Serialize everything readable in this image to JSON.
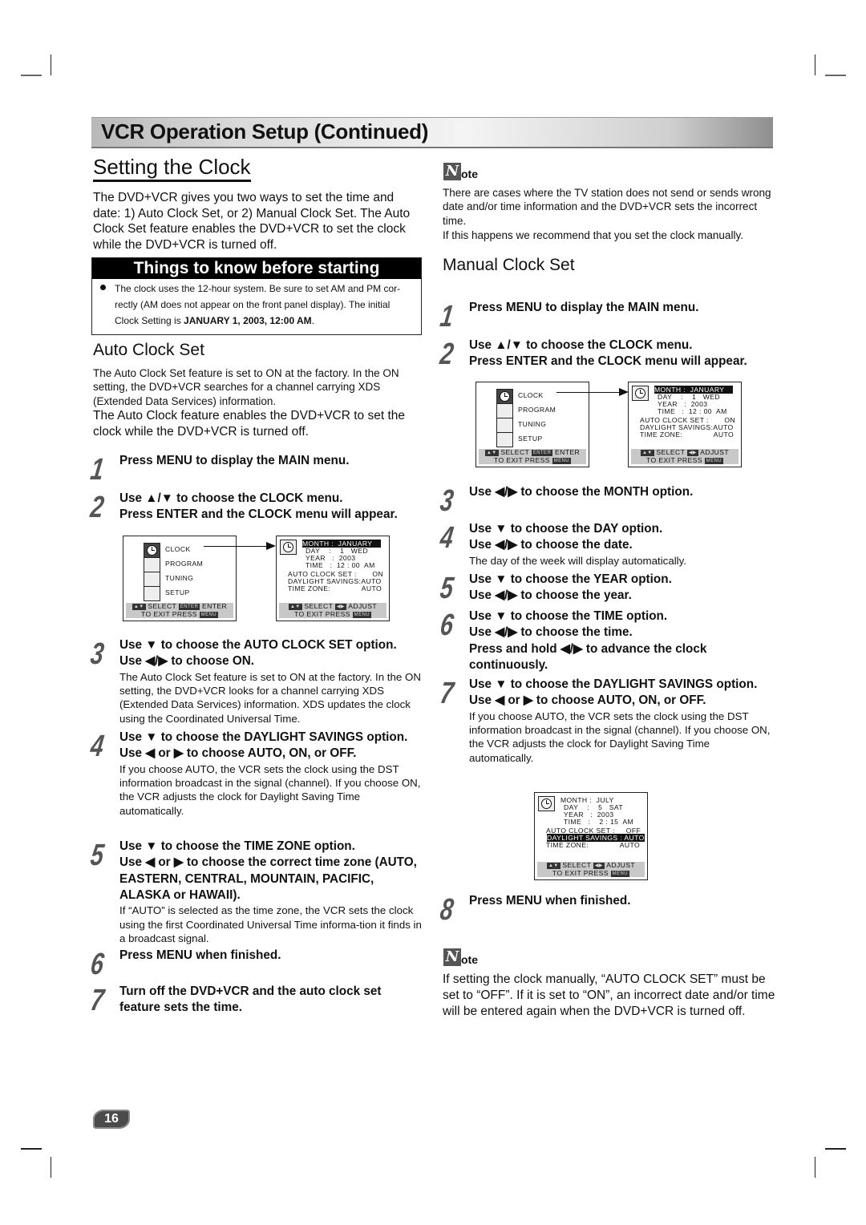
{
  "header": {
    "banner_title": "VCR Operation Setup (Continued)"
  },
  "left": {
    "section_title": "Setting the Clock",
    "intro": "The DVD+VCR gives you two ways to set the time and date: 1) Auto Clock Set, or 2) Manual Clock Set. The Auto Clock Set feature enables the DVD+VCR to set the clock while the DVD+VCR is turned off.",
    "things": {
      "heading": "Things to know before starting",
      "text_a": "The clock uses the 12-hour system. Be sure to set AM and PM cor-rectly (AM does not appear on the front panel display). The initial Clock Setting is ",
      "text_bold": "JANUARY 1, 2003, 12:00 AM",
      "text_end": "."
    },
    "auto_title": "Auto Clock Set",
    "auto_p1": "The Auto Clock Set feature is set to ON at the factory. In the ON setting, the DVD+VCR searches for a channel carrying XDS (Extended Data Services) information.",
    "auto_p2": "The Auto Clock feature enables the DVD+VCR to set the clock while the DVD+VCR is turned off.",
    "steps": [
      {
        "num": "1",
        "bold": [
          "Press MENU to display the MAIN menu."
        ],
        "note": ""
      },
      {
        "num": "2",
        "bold": [
          "Use ▲/▼ to choose the CLOCK menu.",
          "Press ENTER and the CLOCK menu will appear."
        ],
        "note": ""
      },
      {
        "num": "3",
        "bold": [
          "Use ▼ to choose the AUTO CLOCK SET option.",
          "Use ◀/▶ to choose ON."
        ],
        "note": "The Auto Clock Set feature is set to ON at the factory. In the ON setting, the DVD+VCR looks for a channel carrying XDS (Extended Data Services) information. XDS updates the clock using the Coordinated Universal Time."
      },
      {
        "num": "4",
        "bold": [
          "Use ▼ to choose the DAYLIGHT SAVINGS option.",
          "Use ◀ or ▶ to choose AUTO, ON, or OFF."
        ],
        "note": "If you choose AUTO, the VCR sets the clock using the DST information broadcast in the signal (channel). If you choose ON, the VCR adjusts the clock for Daylight Saving Time automatically."
      },
      {
        "num": "5",
        "bold": [
          "Use ▼ to choose the TIME ZONE option.",
          "Use ◀ or ▶ to choose the correct time zone (AUTO, EASTERN, CENTRAL, MOUNTAIN, PACIFIC, ALASKA or HAWAII)."
        ],
        "note": "If “AUTO” is selected as the time zone, the VCR sets the clock using the first Coordinated Universal Time informa-tion it finds in a broadcast signal."
      },
      {
        "num": "6",
        "bold": [
          "Press MENU when finished."
        ],
        "note": ""
      },
      {
        "num": "7",
        "bold": [
          "Turn off the DVD+VCR and the auto clock set feature sets the time."
        ],
        "note": ""
      }
    ]
  },
  "right": {
    "note1": {
      "badge": "N",
      "label": "ote",
      "p1": "There are cases where the TV station does not send or sends wrong date and/or time information and the DVD+VCR sets the incorrect time.",
      "p2": "If this happens we recommend that you set the clock manually."
    },
    "manual_title": "Manual Clock Set",
    "steps": [
      {
        "num": "1",
        "bold": [
          "Press MENU to display the MAIN menu."
        ],
        "note": ""
      },
      {
        "num": "2",
        "bold": [
          "Use ▲/▼ to choose the CLOCK menu.",
          "Press ENTER and the CLOCK menu will appear."
        ],
        "note": ""
      },
      {
        "num": "3",
        "bold": [
          "Use ◀/▶ to choose the MONTH option."
        ],
        "note": ""
      },
      {
        "num": "4",
        "bold": [
          "Use ▼ to choose the DAY option.",
          "Use ◀/▶ to choose the date."
        ],
        "note": "The day of the week will display automatically."
      },
      {
        "num": "5",
        "bold": [
          "Use ▼ to choose the YEAR option.",
          "Use ◀/▶ to choose the year."
        ],
        "note": ""
      },
      {
        "num": "6",
        "bold": [
          "Use ▼ to choose the TIME option.",
          "Use ◀/▶ to choose the time.",
          "Press and hold ◀/▶ to advance the clock continuously."
        ],
        "note": ""
      },
      {
        "num": "7",
        "bold": [
          "Use ▼ to choose the DAYLIGHT SAVINGS option.",
          "Use ◀ or ▶ to choose AUTO, ON, or OFF."
        ],
        "note": "If you choose AUTO, the VCR sets the clock using the DST information broadcast in the signal (channel). If you choose ON, the VCR adjusts the clock for Daylight Saving Time automatically."
      },
      {
        "num": "8",
        "bold": [
          "Press MENU when finished."
        ],
        "note": ""
      }
    ],
    "note2": {
      "badge": "N",
      "label": "ote",
      "p1": "If setting the clock manually, “AUTO CLOCK SET” must be set to “OFF”. If it is set to “ON”, an incorrect date and/or time will be entered again when the DVD+VCR is turned off."
    }
  },
  "osd": {
    "main_menu": {
      "items": [
        "CLOCK",
        "PROGRAM",
        "TUNING",
        "SETUP"
      ],
      "icons": [
        "clock-icon",
        "program-rec-icon",
        "tuning-antenna-icon",
        "setup-icon"
      ],
      "footer_line1": "SELECT",
      "footer_key_enter": "ENTER",
      "footer_enter_label": "ENTER",
      "footer_line2": "TO  EXIT PRESS",
      "footer_key_menu": "MENU"
    },
    "clock_menu_jan": {
      "rows": [
        "MONTH :  JANUARY",
        "DAY    :    1   WED",
        "YEAR   :  2003",
        "TIME   :  12 : 00  AM"
      ],
      "auto_clock_set": "AUTO CLOCK SET :       ON",
      "daylight": "DAYLIGHT SAVINGS:AUTO",
      "time_zone": "TIME ZONE:              AUTO",
      "highlighted_row": "MONTH",
      "footer_line1a": "SELECT",
      "footer_line1b": "ADJUST",
      "footer_line2": "TO  EXIT PRESS",
      "footer_key_menu": "MENU"
    },
    "clock_menu_jul": {
      "rows": [
        "MONTH :  JULY",
        "DAY    :    5   SAT",
        "YEAR   :  2003",
        "TIME   :    2 : 15  AM"
      ],
      "auto_clock_set": "AUTO CLOCK SET :     OFF",
      "daylight": "DAYLIGHT SAVINGS : AUTO",
      "time_zone": "TIME ZONE:              AUTO",
      "highlighted_row": "DAYLIGHT SAVINGS",
      "footer_line1a": "SELECT",
      "footer_line1b": "ADJUST",
      "footer_line2": "TO  EXIT PRESS",
      "footer_key_menu": "MENU"
    }
  },
  "footer": {
    "page_number": "16"
  }
}
